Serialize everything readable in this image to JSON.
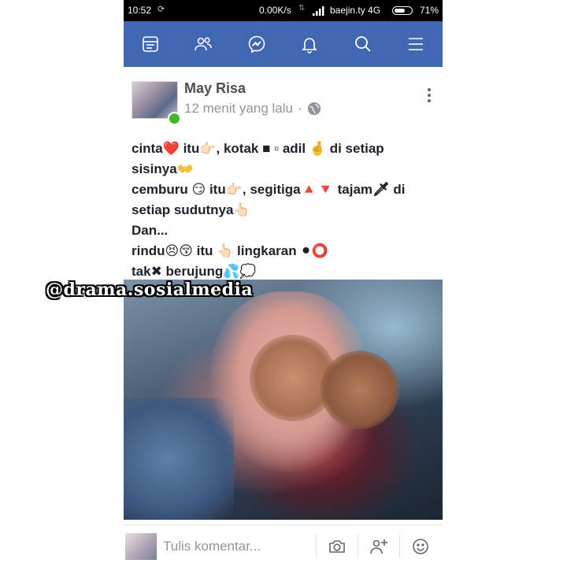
{
  "status_bar": {
    "time": "10:52",
    "network_speed": "0.00K/s",
    "carrier": "baejin.ty 4G",
    "battery": "71%",
    "battery_level": 0.71
  },
  "nav": {
    "items": [
      "news-feed-icon",
      "friends-icon",
      "messenger-icon",
      "notifications-icon",
      "search-icon",
      "menu-icon"
    ],
    "color": "#4267b2"
  },
  "post": {
    "author": "May Risa",
    "timestamp": "12 menit yang lalu",
    "separator": "·",
    "lines": [
      "cinta❤️ itu👉🏻, kotak ■ ▫ adil 🤞 di setiap",
      "sisinya👐",
      "cemburu 😏 itu👉🏻, segitiga🔺🔻 tajam🗡 di",
      "setiap sudutnya👆🏻",
      "Dan...",
      "rindu😣😚 itu 👆🏻 lingkaran ⚫⭕",
      "tak✖ berujung💦💭"
    ]
  },
  "watermark": "@drama.sosialmedia",
  "comment_bar": {
    "placeholder": "Tulis komentar...",
    "icons": [
      "camera-icon",
      "add-friend-icon",
      "emoji-icon"
    ]
  }
}
